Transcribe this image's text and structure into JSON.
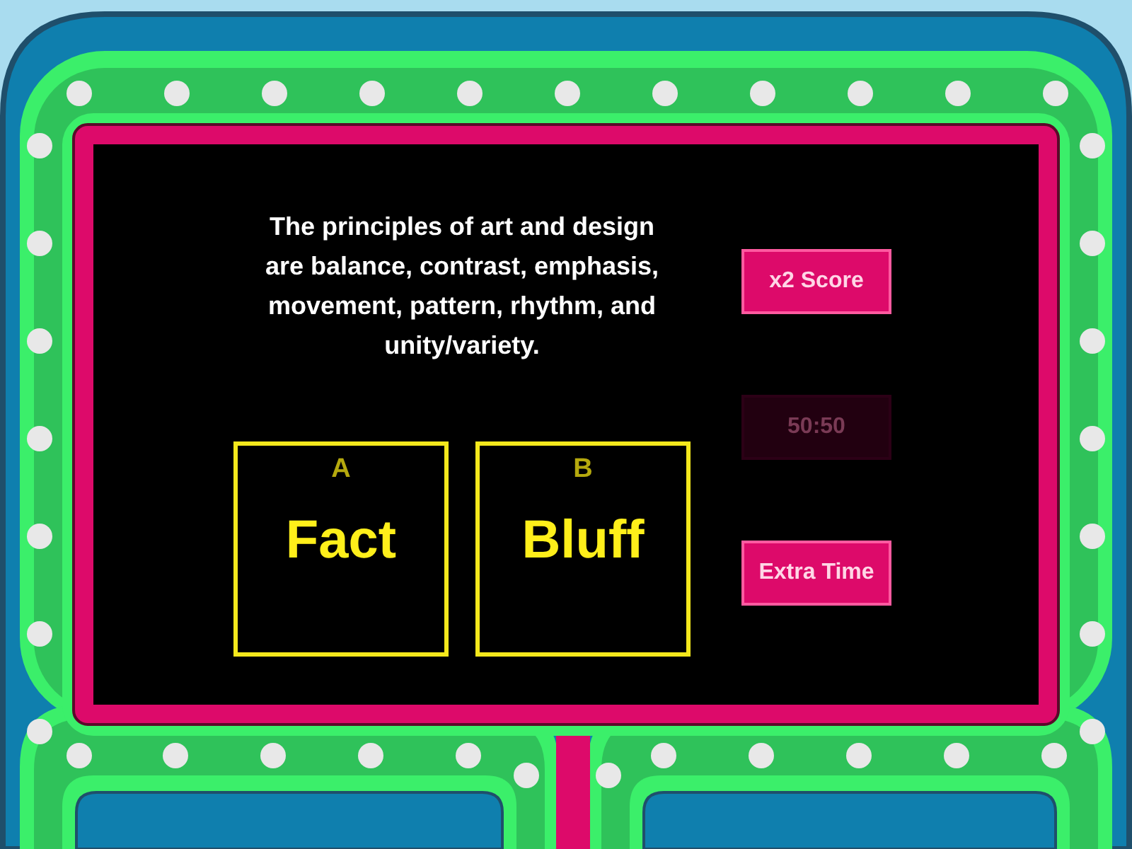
{
  "question": "The principles of art and design are balance, contrast, emphasis, movement, pattern, rhythm, and unity/variety.",
  "answers": [
    {
      "letter": "A",
      "text": "Fact"
    },
    {
      "letter": "B",
      "text": "Bluff"
    }
  ],
  "powerups": [
    {
      "label": "x2 Score",
      "disabled": false
    },
    {
      "label": "50:50",
      "disabled": true
    },
    {
      "label": "Extra Time",
      "disabled": false
    }
  ]
}
